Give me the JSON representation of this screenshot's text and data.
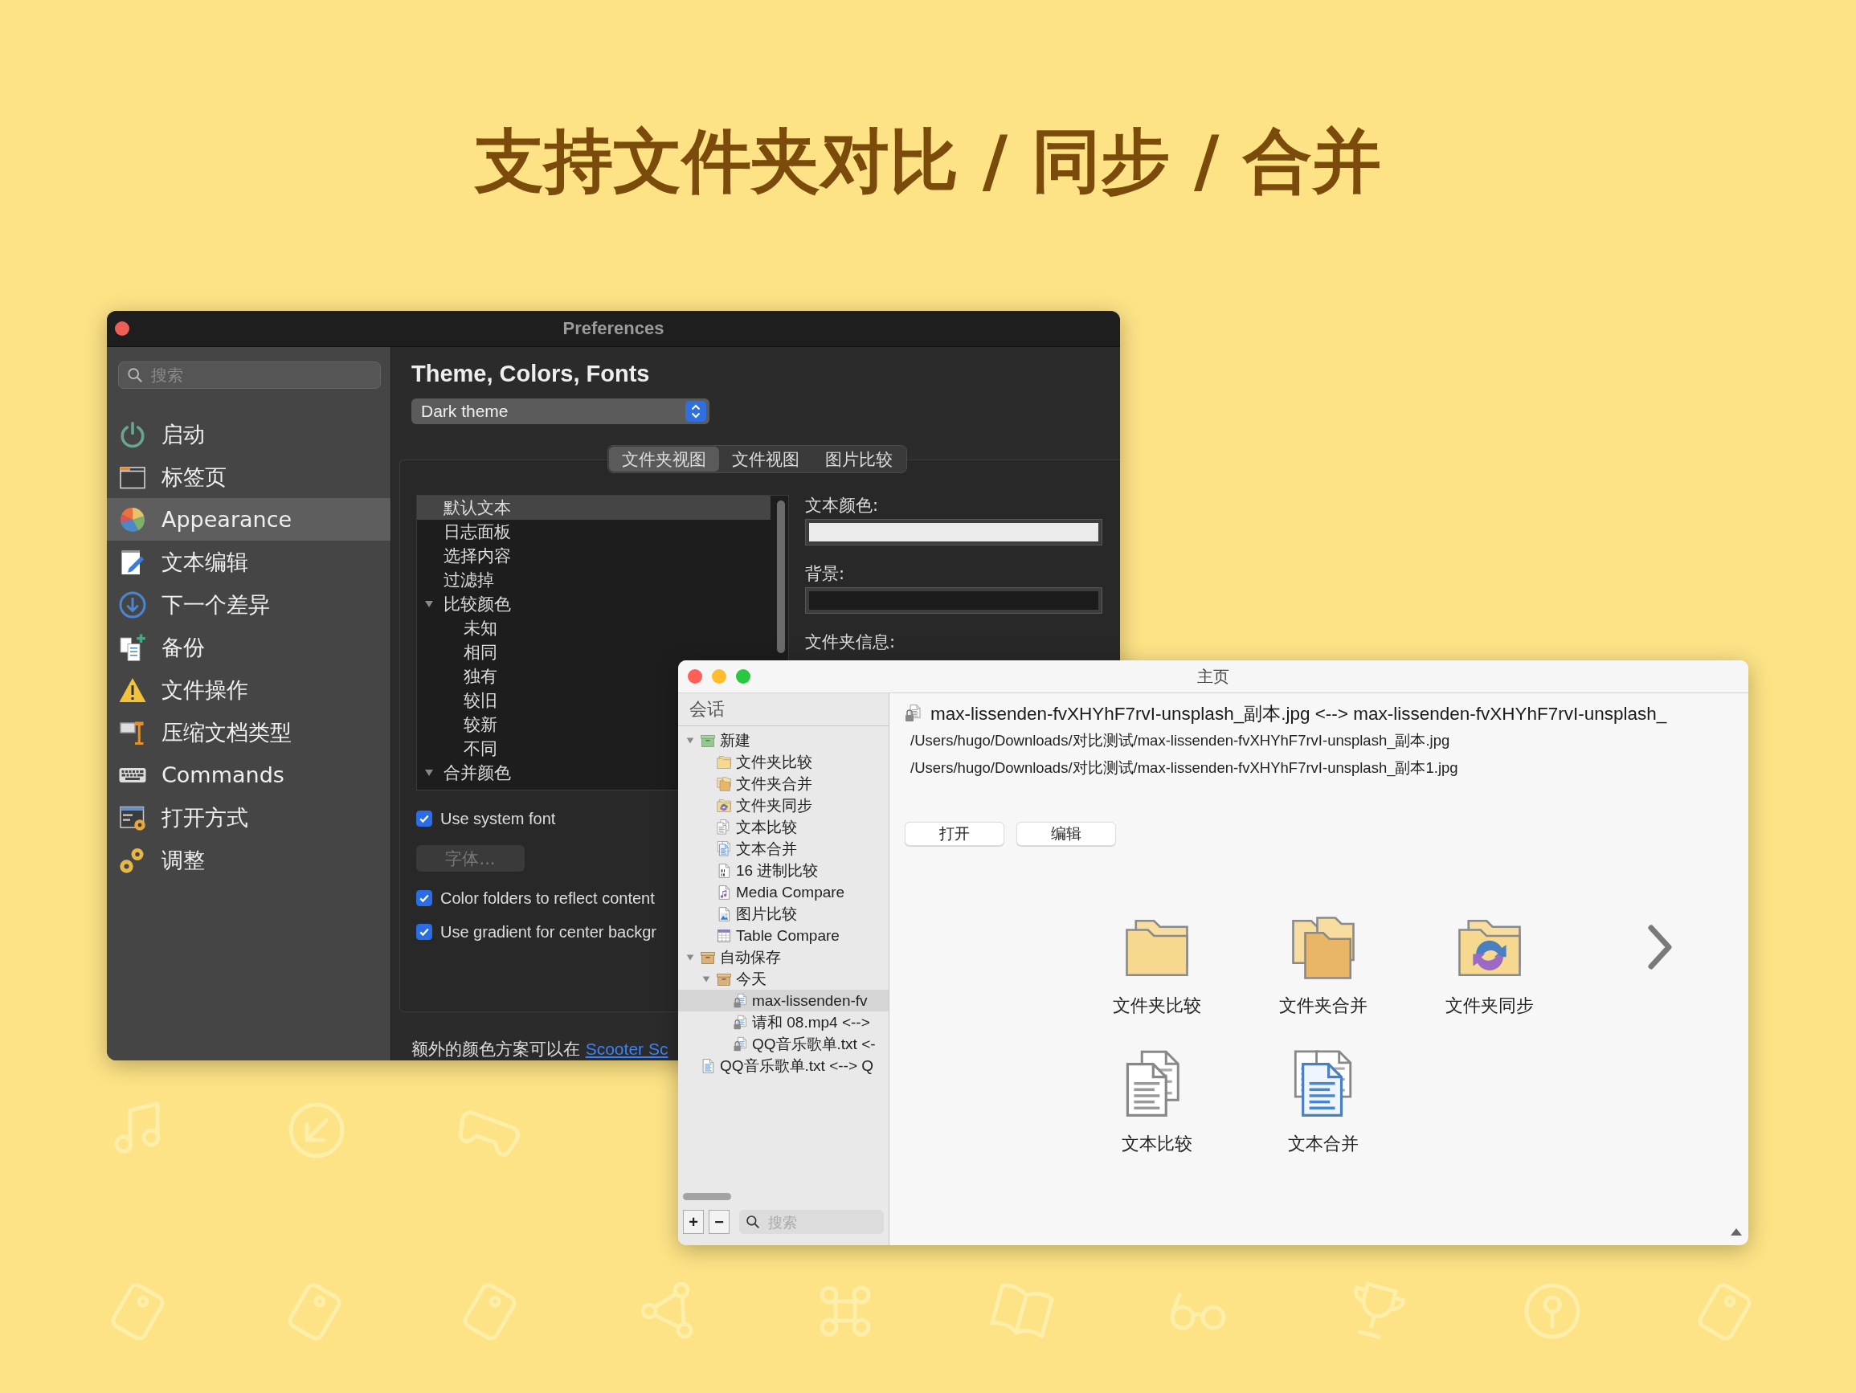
{
  "headline": "支持文件夹对比 / 同步 / 合并",
  "preferences": {
    "title": "Preferences",
    "search": {
      "placeholder": "搜索"
    },
    "sidebar": [
      {
        "label": "启动",
        "kind": "power",
        "selected": false
      },
      {
        "label": "标签页",
        "kind": "tabs",
        "selected": false
      },
      {
        "label": "Appearance",
        "kind": "appearance",
        "selected": true
      },
      {
        "label": "文本编辑",
        "kind": "edit",
        "selected": false
      },
      {
        "label": "下一个差异",
        "kind": "next",
        "selected": false
      },
      {
        "label": "备份",
        "kind": "backup",
        "selected": false
      },
      {
        "label": "文件操作",
        "kind": "warning",
        "selected": false
      },
      {
        "label": "压缩文档类型",
        "kind": "archive",
        "selected": false
      },
      {
        "label": "Commands",
        "kind": "keyboard",
        "selected": false
      },
      {
        "label": "打开方式",
        "kind": "open-with",
        "selected": false
      },
      {
        "label": "调整",
        "kind": "tweak",
        "selected": false
      }
    ],
    "heading": "Theme, Colors, Fonts",
    "theme_popup": {
      "value": "Dark theme"
    },
    "tabs": [
      {
        "label": "文件夹视图",
        "selected": true
      },
      {
        "label": "文件视图",
        "selected": false
      },
      {
        "label": "图片比较",
        "selected": false
      }
    ],
    "color_tree": [
      {
        "label": "默认文本",
        "selected": true
      },
      {
        "label": "日志面板",
        "selected": false
      },
      {
        "label": "选择内容",
        "selected": false
      },
      {
        "label": "过滤掉",
        "selected": false
      },
      {
        "label": "比较颜色",
        "selected": false,
        "expanded": true,
        "children": [
          {
            "label": "未知",
            "selected": false
          },
          {
            "label": "相同",
            "selected": false
          },
          {
            "label": "独有",
            "selected": false
          },
          {
            "label": "较旧",
            "selected": false
          },
          {
            "label": "较新",
            "selected": false
          },
          {
            "label": "不同",
            "selected": false
          }
        ]
      },
      {
        "label": "合并颜色",
        "selected": false,
        "expanded": true
      }
    ],
    "swatches": [
      {
        "label": "文本颜色:",
        "color": "#ebebeb"
      },
      {
        "label": "背景:",
        "color": "#1c1c1c"
      }
    ],
    "folder_info_label": "文件夹信息:",
    "options": [
      {
        "kind": "checkbox",
        "label": "Use system font",
        "checked": true
      },
      {
        "kind": "button",
        "label": "字体...",
        "disabled": true
      },
      {
        "kind": "checkbox",
        "label": "Color folders to reflect content",
        "checked": true
      },
      {
        "kind": "checkbox",
        "label": "Use gradient for center backgr",
        "checked": true
      }
    ],
    "footer": {
      "text": "额外的颜色方案可以在 ",
      "link": "Scooter Sc"
    }
  },
  "main_window": {
    "title": "主页",
    "sidebar": {
      "header": "会话",
      "tree": [
        {
          "label": "新建",
          "kind": "group-new",
          "selected": false,
          "expanded": true,
          "children": [
            {
              "label": "文件夹比较",
              "kind": "folder",
              "selected": false
            },
            {
              "label": "文件夹合并",
              "kind": "folder-merge",
              "selected": false
            },
            {
              "label": "文件夹同步",
              "kind": "folder-sync",
              "selected": false
            },
            {
              "label": "文本比较",
              "kind": "text",
              "selected": false
            },
            {
              "label": "文本合并",
              "kind": "text-merge",
              "selected": false
            },
            {
              "label": "16 进制比较",
              "kind": "hex",
              "selected": false
            },
            {
              "label": "Media Compare",
              "kind": "media",
              "selected": false
            },
            {
              "label": "图片比较",
              "kind": "image",
              "selected": false
            },
            {
              "label": "Table Compare",
              "kind": "table",
              "selected": false
            }
          ]
        },
        {
          "label": "自动保存",
          "kind": "group-auto",
          "selected": false,
          "expanded": true,
          "children": [
            {
              "label": "今天",
              "kind": "group-auto",
              "selected": false,
              "expanded": true,
              "children": [
                {
                  "label": "max-lissenden-fv",
                  "kind": "locked",
                  "selected": true
                },
                {
                  "label": "请和 08.mp4 <-->",
                  "kind": "locked",
                  "selected": false
                },
                {
                  "label": "QQ音乐歌单.txt <-",
                  "kind": "locked",
                  "selected": false
                }
              ]
            }
          ]
        },
        {
          "label": "QQ音乐歌单.txt <--> Q",
          "kind": "session-text",
          "selected": false
        }
      ],
      "buttons": [
        "+",
        "−"
      ],
      "search": {
        "placeholder": "搜索"
      }
    },
    "session": {
      "title": "max-lissenden-fvXHYhF7rvI-unsplash_副本.jpg <--> max-lissenden-fvXHYhF7rvI-unsplash_",
      "paths": [
        "/Users/hugo/Downloads/对比测试/max-lissenden-fvXHYhF7rvI-unsplash_副本.jpg",
        "/Users/hugo/Downloads/对比测试/max-lissenden-fvXHYhF7rvI-unsplash_副本1.jpg"
      ],
      "buttons": [
        "打开",
        "编辑"
      ]
    },
    "launchers": [
      {
        "label": "文件夹比较",
        "kind": "folder"
      },
      {
        "label": "文件夹合并",
        "kind": "folder-merge"
      },
      {
        "label": "文件夹同步",
        "kind": "folder-sync"
      },
      {
        "label": "文本比较",
        "kind": "text"
      },
      {
        "label": "文本合并",
        "kind": "text-merge"
      }
    ]
  }
}
